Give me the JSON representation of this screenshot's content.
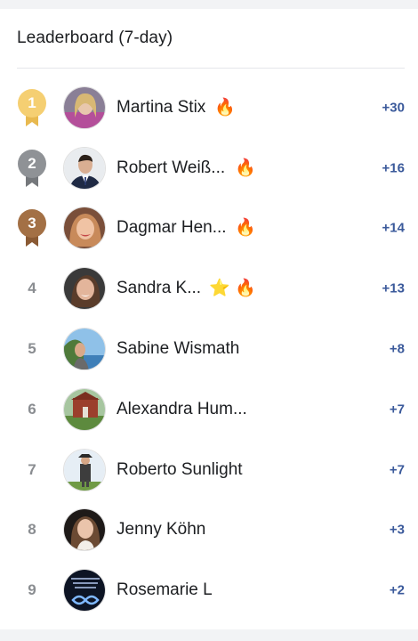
{
  "header": {
    "title": "Leaderboard (7-day)"
  },
  "colors": {
    "gold": "#f5cf72",
    "silver": "#8f9296",
    "bronze": "#a37045",
    "points": "#3b5a9b"
  },
  "entries": [
    {
      "rank": "1",
      "name": "Martina Stix",
      "badges": [
        "fire-icon"
      ],
      "points": "+30"
    },
    {
      "rank": "2",
      "name": "Robert Weiß...",
      "badges": [
        "fire-icon"
      ],
      "points": "+16"
    },
    {
      "rank": "3",
      "name": "Dagmar Hen...",
      "badges": [
        "fire-icon"
      ],
      "points": "+14"
    },
    {
      "rank": "4",
      "name": "Sandra K...",
      "badges": [
        "star-icon",
        "fire-icon"
      ],
      "points": "+13"
    },
    {
      "rank": "5",
      "name": "Sabine Wismath",
      "badges": [],
      "points": "+8"
    },
    {
      "rank": "6",
      "name": "Alexandra Hum...",
      "badges": [],
      "points": "+7"
    },
    {
      "rank": "7",
      "name": "Roberto Sunlight",
      "badges": [],
      "points": "+7"
    },
    {
      "rank": "8",
      "name": "Jenny Köhn",
      "badges": [],
      "points": "+3"
    },
    {
      "rank": "9",
      "name": "Rosemarie L",
      "badges": [],
      "points": "+2"
    }
  ]
}
